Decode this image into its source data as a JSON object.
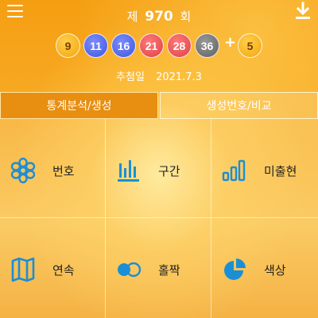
{
  "header": {
    "draw_prefix": "제",
    "draw_number": "970",
    "draw_suffix": "회",
    "numbers": [
      "9",
      "11",
      "16",
      "21",
      "28",
      "36"
    ],
    "plus_sign": "+",
    "bonus": "5",
    "date_label": "추첨일",
    "date_value": "2021.7.3",
    "ball_colors": {
      "yellow": "#f3a50f",
      "blue": "#3f56d8",
      "red": "#de4141",
      "gray": "#5e5e5e"
    }
  },
  "tabs": [
    {
      "label": "통계분석/생성",
      "active": true
    },
    {
      "label": "생성번호/비교",
      "active": false
    }
  ],
  "menu": [
    {
      "label": "번호",
      "icon": "flower-icon"
    },
    {
      "label": "구간",
      "icon": "bar-chart-icon"
    },
    {
      "label": "미출현",
      "icon": "signal-bars-icon"
    },
    {
      "label": "연속",
      "icon": "map-icon"
    },
    {
      "label": "홀짝",
      "icon": "toggle-circles-icon"
    },
    {
      "label": "색상",
      "icon": "pie-chart-icon"
    }
  ],
  "accent_color": "#1a8fd6"
}
